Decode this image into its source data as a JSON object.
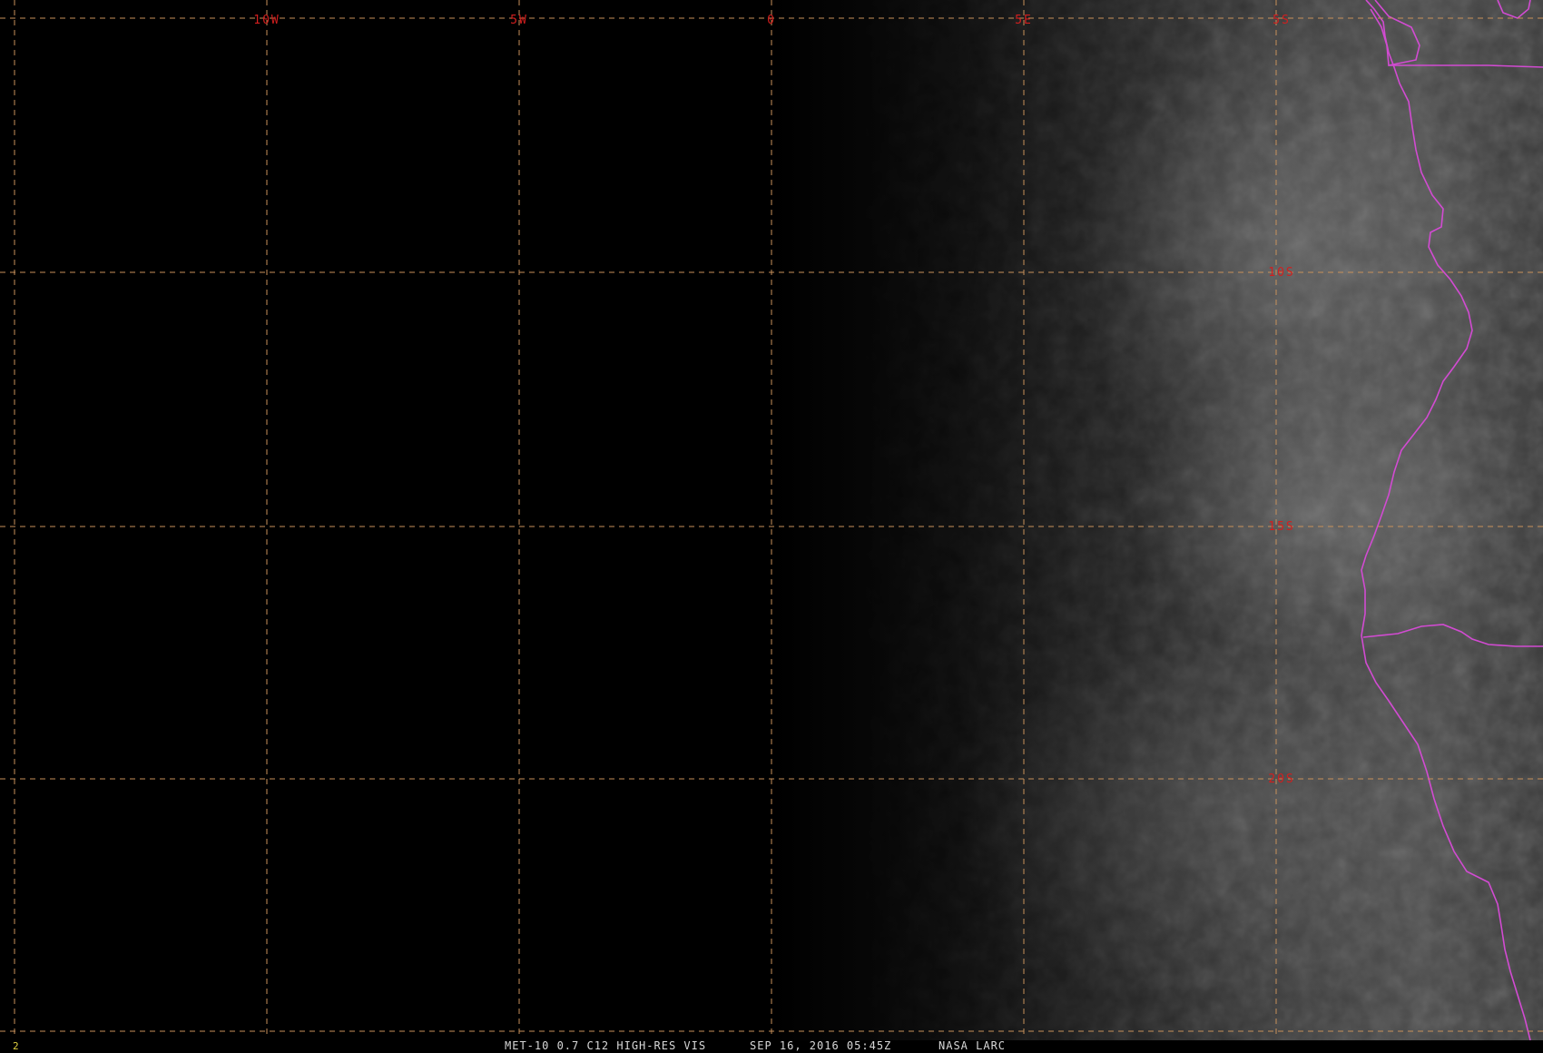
{
  "image": {
    "frame_number": "2",
    "caption": {
      "product": "MET-10 0.7 C12 HIGH-RES VIS",
      "datetime": "SEP 16, 2016 05:45Z",
      "source": "NASA LARC"
    }
  },
  "grid": {
    "longitude_labels": [
      "10W",
      "5W",
      "0",
      "5E"
    ],
    "latitude_labels": [
      "5S",
      "10S",
      "15S",
      "20S"
    ]
  },
  "colors": {
    "grid_line": "#c8915a",
    "grid_label": "#d21e1e",
    "coastline": "#d24bd2",
    "frame_number": "#e0d040",
    "caption_text": "#d8d8d8"
  }
}
